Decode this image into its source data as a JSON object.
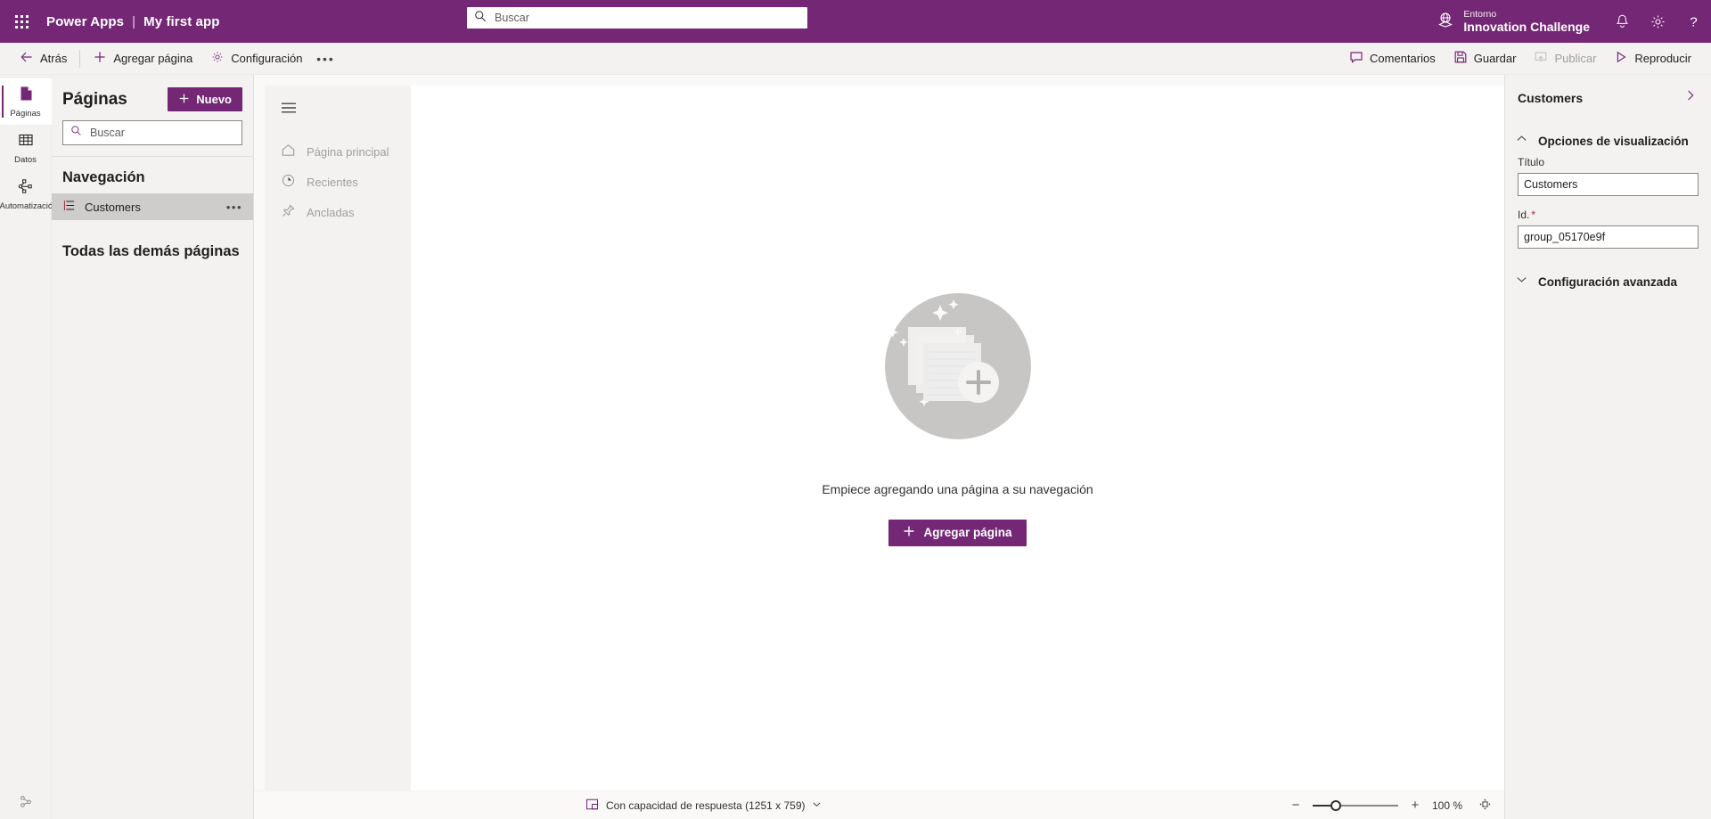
{
  "header": {
    "waffle_icon": "waffle-grid-icon",
    "brand": "Power Apps",
    "separator": "|",
    "app_name": "My first app",
    "search": {
      "placeholder": "Buscar",
      "value": "",
      "icon": "search-icon"
    },
    "environment": {
      "label": "Entorno",
      "name": "Innovation Challenge",
      "icon": "environment-globe-icon"
    },
    "icons": [
      {
        "name": "notification-bell-icon",
        "glyph": "bell"
      },
      {
        "name": "settings-gear-icon",
        "glyph": "gear"
      },
      {
        "name": "help-question-icon",
        "glyph": "?"
      }
    ],
    "accent_color": "#742774"
  },
  "commandbar": {
    "back": "Atrás",
    "add_page": "Agregar página",
    "settings": "Configuración",
    "overflow": "•••",
    "comments": "Comentarios",
    "save": "Guardar",
    "publish": "Publicar",
    "publish_disabled": true,
    "play": "Reproducir"
  },
  "rail": {
    "items": [
      {
        "label": "Páginas",
        "icon": "pages-document-icon",
        "active": true
      },
      {
        "label": "Datos",
        "icon": "data-table-icon",
        "active": false
      },
      {
        "label": "Automatizació",
        "icon": "automation-flow-icon",
        "active": false
      }
    ],
    "bottom_icon": "add-connector-icon"
  },
  "pages_panel": {
    "title": "Páginas",
    "new_button": "Nuevo",
    "search": {
      "placeholder": "Buscar",
      "value": "",
      "icon": "search-icon"
    },
    "navigation_section": "Navegación",
    "tree_items": [
      {
        "label": "Customers",
        "icon": "group-list-icon",
        "selected": true,
        "more": "•••"
      }
    ],
    "other_pages_section": "Todas las demás páginas"
  },
  "nav_preview": {
    "hamburger_icon": "hamburger-menu-icon",
    "items": [
      {
        "label": "Página principal",
        "icon": "home-icon"
      },
      {
        "label": "Recientes",
        "icon": "clock-recent-icon"
      },
      {
        "label": "Ancladas",
        "icon": "pin-icon"
      }
    ]
  },
  "stage": {
    "empty_illustration": "stacked-pages-plus-illustration",
    "empty_message": "Empiece agregando una página a su navegación",
    "add_page_button": "Agregar página"
  },
  "statusbar": {
    "screen_size_icon": "responsive-screen-icon",
    "screen_size_label": "Con capacidad de respuesta (1251 x 759)",
    "chevron_icon": "chevron-down-icon",
    "zoom_minus": "−",
    "zoom_plus": "+",
    "zoom_value": "100 %",
    "fit_icon": "fit-to-screen-icon"
  },
  "properties": {
    "title": "Customers",
    "collapse_icon": "chevron-right-icon",
    "display_options_section": "Opciones de visualización",
    "display_options_chevron": "chevron-up-icon",
    "title_field_label": "Título",
    "title_field_value": "Customers",
    "id_field_label": "Id.",
    "id_field_required": "*",
    "id_field_value": "group_05170e9f",
    "advanced_section": "Configuración avanzada",
    "advanced_chevron": "chevron-down-icon"
  }
}
